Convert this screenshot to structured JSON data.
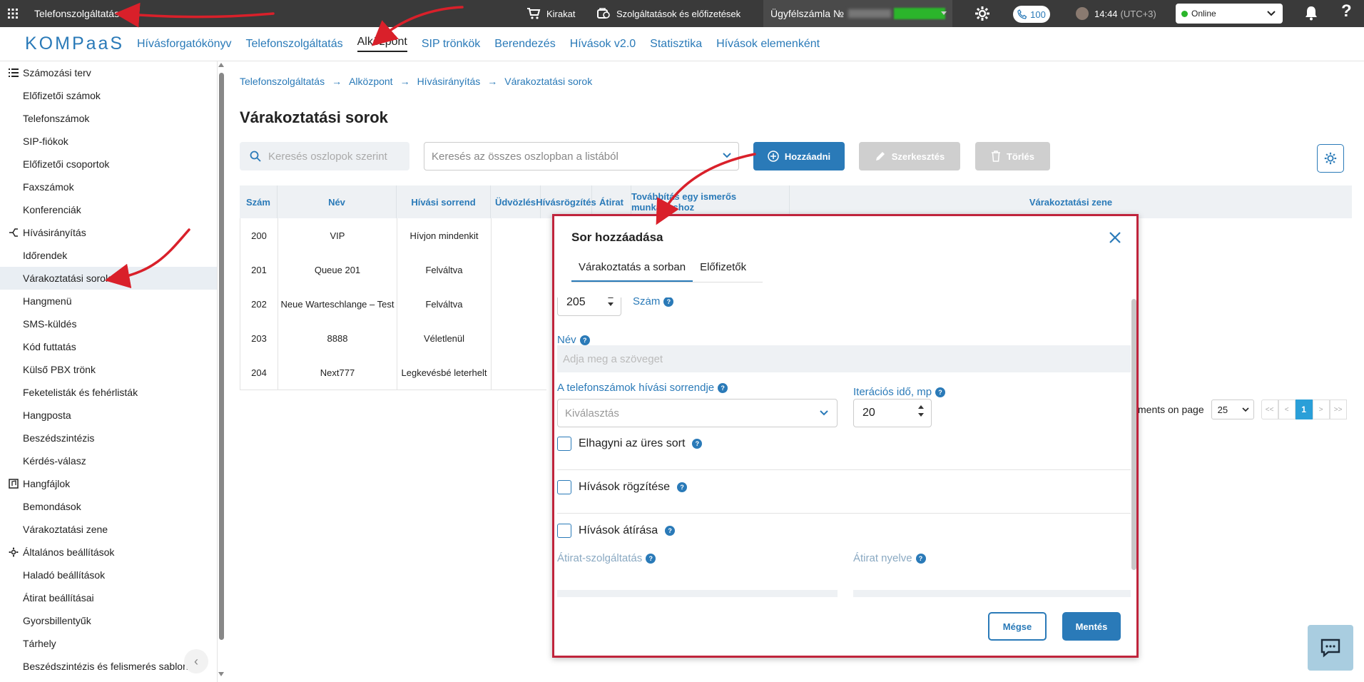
{
  "topbar": {
    "title": "Telefonszolgáltatás",
    "shop_label": "Kirakat",
    "services_label": "Szolgáltatások és előfizetések",
    "account_label": "Ügyfélszámla №",
    "calls_count": "100",
    "time": "14:44",
    "timezone": "(UTC+3)",
    "status": "Online",
    "help": "?"
  },
  "nav": {
    "logo": "KOMPaaS",
    "links": [
      "Hívásforgatókönyv",
      "Telefonszolgáltatás",
      "Alközpont",
      "SIP trönkök",
      "Berendezés",
      "Hívások v2.0",
      "Statisztika",
      "Hívások elemenként"
    ],
    "active": "Alközpont"
  },
  "sidebar": {
    "sections": [
      {
        "title": "Számozási terv",
        "icon": "list-icon",
        "items": [
          "Előfizetői számok",
          "Telefonszámok",
          "SIP-fiókok",
          "Előfizetői csoportok",
          "Faxszámok",
          "Konferenciák"
        ]
      },
      {
        "title": "Hívásirányítás",
        "icon": "routing-icon",
        "items": [
          "Időrendek",
          "Várakoztatási sorok",
          "Hangmenü",
          "SMS-küldés",
          "Kód futtatás",
          "Külső PBX trönk",
          "Feketelisták és fehérlisták",
          "Hangposta",
          "Beszédszintézis",
          "Kérdés-válasz"
        ]
      },
      {
        "title": "Hangfájlok",
        "icon": "audio-file-icon",
        "items": [
          "Bemondások",
          "Várakoztatási zene"
        ]
      },
      {
        "title": "Általános beállítások",
        "icon": "gear-icon",
        "items": [
          "Haladó beállítások",
          "Átirat beállításai",
          "Gyorsbillentyűk",
          "Tárhely",
          "Beszédszintézis és felismerés sablon"
        ]
      }
    ],
    "active_item": "Várakoztatási sorok"
  },
  "breadcrumb": [
    "Telefonszolgáltatás",
    "Alközpont",
    "Hívásirányítás",
    "Várakoztatási sorok"
  ],
  "page": {
    "title": "Várakoztatási sorok",
    "search_columns_placeholder": "Keresés oszlopok szerint",
    "search_all_placeholder": "Keresés az összes oszlopban a listából",
    "add_label": "Hozzáadni",
    "edit_label": "Szerkesztés",
    "delete_label": "Törlés"
  },
  "table": {
    "headers": [
      "Szám",
      "Név",
      "Hívási sorrend",
      "Üdvözlés",
      "Hívásrögzítés",
      "Átirat",
      "Továbbítás egy ismerős munkatárshoz",
      "Várakoztatási zene"
    ],
    "rows": [
      [
        "200",
        "VIP",
        "Hívjon mindenkit"
      ],
      [
        "201",
        "Queue 201",
        "Felváltva"
      ],
      [
        "202",
        "Neue Warteschlange – Test",
        "Felváltva"
      ],
      [
        "203",
        "8888",
        "Véletlenül"
      ],
      [
        "204",
        "Next777",
        "Legkevésbé leterhelt"
      ]
    ]
  },
  "pager": {
    "label": "ments on page",
    "page_size": "25",
    "first": "<<",
    "prev": "<",
    "current": "1",
    "next": ">",
    "last": ">>"
  },
  "modal": {
    "title": "Sor hozzáadása",
    "tabs": [
      "Várakoztatás a sorban",
      "Előfizetők"
    ],
    "number_value": "205",
    "number_label": "Szám",
    "name_label": "Név",
    "name_placeholder": "Adja meg a szöveget",
    "order_label": "A telefonszámok hívási sorrendje",
    "order_placeholder": "Kiválasztás",
    "iteration_label": "Iterációs idő, mp",
    "iteration_value": "20",
    "skip_empty_label": "Elhagyni az üres sort",
    "record_label": "Hívások rögzítése",
    "transcribe_label": "Hívások átírása",
    "transcript_service_label": "Átirat-szolgáltatás",
    "transcript_lang_label": "Átirat nyelve",
    "cancel_label": "Mégse",
    "save_label": "Mentés",
    "help": "?"
  },
  "colors": {
    "accent": "#2a7ab8",
    "highlight": "#c0243c",
    "topbar": "#3a3a3a"
  }
}
